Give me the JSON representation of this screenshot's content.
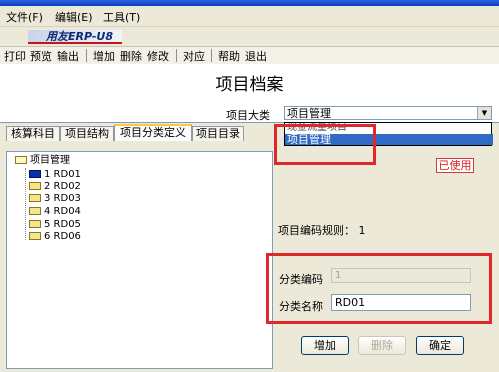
{
  "colors": {
    "highlight": "#e0282a",
    "selection": "#316ac5",
    "badge": "#d42020"
  },
  "menubar": {
    "items": [
      "文件(F)",
      "编辑(E)",
      "工具(T)"
    ]
  },
  "logo": {
    "text": "用友ERP-U8"
  },
  "toolbar": {
    "items": [
      "打印",
      "预览",
      "输出",
      "增加",
      "删除",
      "修改",
      "对应",
      "帮助",
      "退出"
    ]
  },
  "header": {
    "title": "项目档案",
    "category_label": "项目大类",
    "category_value": "项目管理",
    "dropdown_options": [
      "现金流量项目",
      "项目管理"
    ],
    "dropdown_selected": "项目管理"
  },
  "tabs": [
    "核算科目",
    "项目结构",
    "项目分类定义",
    "项目目录"
  ],
  "active_tab": "项目分类定义",
  "tree": {
    "root": "项目管理",
    "children": [
      "1 RD01",
      "2 RD02",
      "3 RD03",
      "4 RD04",
      "5 RD05",
      "6 RD06"
    ]
  },
  "right_panel": {
    "status_badge": "已使用",
    "rule_text": "项目编码规则： 1",
    "code_label": "分类编码",
    "code_value": "1",
    "name_label": "分类名称",
    "name_value": "RD01"
  },
  "buttons": {
    "add": "增加",
    "delete": "删除",
    "confirm": "确定"
  },
  "icons": {
    "root_folder": "open-folder-icon",
    "child_folder": "folder-icon",
    "dropdown": "chevron-down-icon"
  }
}
